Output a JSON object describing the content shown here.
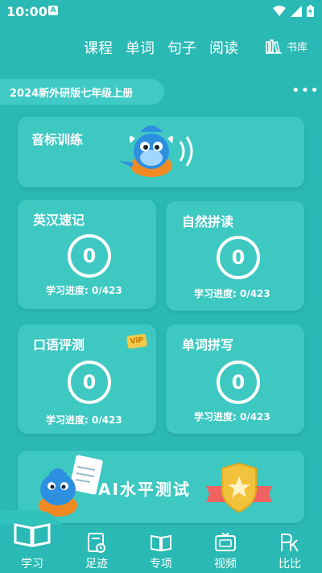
{
  "status": {
    "time": "10:00",
    "notification_letter": "A"
  },
  "top_tabs": [
    "课程",
    "单词",
    "句子",
    "阅读"
  ],
  "bookshelf_label": "书库",
  "edition": "2024新外研版七年级上册",
  "cards": {
    "phonics": {
      "title": "音标训练"
    },
    "quick_memory": {
      "title": "英汉速记",
      "count": "0",
      "progress": "学习进度: 0/423"
    },
    "natural_phonics": {
      "title": "自然拼读",
      "count": "0",
      "progress": "学习进度: 0/423"
    },
    "oral_test": {
      "title": "口语评测",
      "count": "0",
      "progress": "学习进度: 0/423",
      "badge": "ViP"
    },
    "spelling": {
      "title": "单词拼写",
      "count": "0",
      "progress": "学习进度: 0/423"
    },
    "ai_test": {
      "title": "AI水平测试"
    }
  },
  "bottom_nav": [
    {
      "label": "学习",
      "icon": "book-icon"
    },
    {
      "label": "足迹",
      "icon": "history-icon"
    },
    {
      "label": "专项",
      "icon": "open-book-icon"
    },
    {
      "label": "视频",
      "icon": "tv-icon"
    },
    {
      "label": "比比",
      "icon": "pk-icon"
    }
  ],
  "colors": {
    "background": "#2ab9b4",
    "card": "#3ec8c2",
    "badge": "#f3c94a",
    "shield": "#f2c23c",
    "ribbon": "#f06262"
  }
}
